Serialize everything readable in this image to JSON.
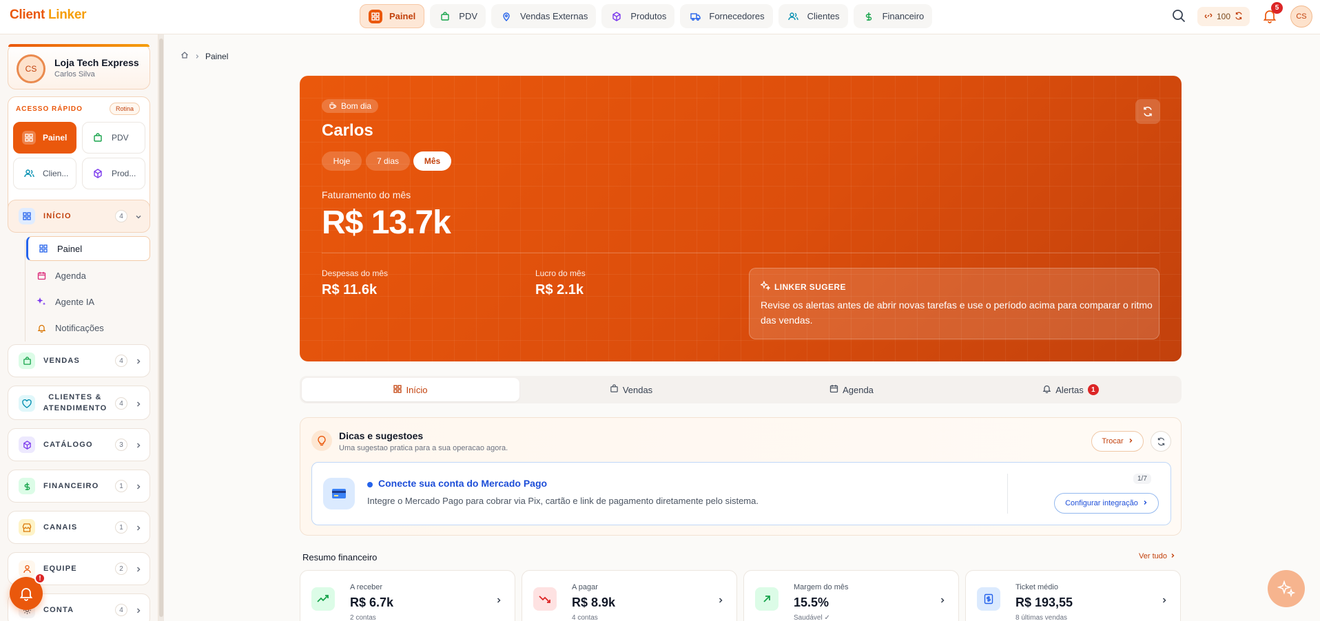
{
  "app": {
    "brand_1": "Client",
    "brand_2": "Linker"
  },
  "nav": [
    {
      "label": "Painel",
      "icon": "grid-icon"
    },
    {
      "label": "PDV",
      "icon": "bag-icon"
    },
    {
      "label": "Vendas Externas",
      "icon": "map-pin-icon"
    },
    {
      "label": "Produtos",
      "icon": "box-icon"
    },
    {
      "label": "Fornecedores",
      "icon": "truck-icon"
    },
    {
      "label": "Clientes",
      "icon": "users-icon"
    },
    {
      "label": "Financeiro",
      "icon": "dollar-icon"
    }
  ],
  "topbar": {
    "coins": "100",
    "notifications": "5",
    "avatar": "CS"
  },
  "store": {
    "initials": "CS",
    "name": "Loja Tech Express",
    "user": "Carlos Silva"
  },
  "quick": {
    "title": "ACESSO RÁPIDO",
    "tag": "Rotina",
    "items": [
      {
        "label": "Painel"
      },
      {
        "label": "PDV"
      },
      {
        "label": "Clien..."
      },
      {
        "label": "Prod..."
      }
    ]
  },
  "groups": [
    {
      "label": "INÍCIO",
      "count": "4"
    },
    {
      "label": "VENDAS",
      "count": "4"
    },
    {
      "label": "CLIENTES &",
      "label2": "ATENDIMENTO",
      "count": "4"
    },
    {
      "label": "CATÁLOGO",
      "count": "3"
    },
    {
      "label": "FINANCEIRO",
      "count": "1"
    },
    {
      "label": "CANAIS",
      "count": "1"
    },
    {
      "label": "EQUIPE",
      "count": "2"
    },
    {
      "label": "CONTA",
      "count": "4"
    }
  ],
  "inicio_items": [
    {
      "label": "Painel"
    },
    {
      "label": "Agenda"
    },
    {
      "label": "Agente IA"
    },
    {
      "label": "Notificações"
    }
  ],
  "float_badge": "!",
  "breadcrumb": {
    "current": "Painel"
  },
  "hero": {
    "greeting": "Bom dia",
    "name": "Carlos",
    "periods": [
      "Hoje",
      "7 dias",
      "Mês"
    ],
    "revenue_label": "Faturamento do mês",
    "revenue_value": "R$ 13.7k",
    "expenses_label": "Despesas do mês",
    "expenses_value": "R$ 11.6k",
    "profit_label": "Lucro do mês",
    "profit_value": "R$ 2.1k",
    "suggest_title": "LINKER SUGERE",
    "suggest_body": "Revise os alertas antes de abrir novas tarefas e use o período acima para comparar o ritmo das vendas."
  },
  "tabs": [
    {
      "label": "Início"
    },
    {
      "label": "Vendas"
    },
    {
      "label": "Agenda"
    },
    {
      "label": "Alertas",
      "badge": "1"
    }
  ],
  "tips": {
    "title": "Dicas e sugestoes",
    "subtitle": "Uma sugestao pratica para a sua operacao agora.",
    "swap": "Trocar",
    "card_title": "Conecte sua conta do Mercado Pago",
    "card_body": "Integre o Mercado Pago para cobrar via Pix, cartão e link de pagamento diretamente pelo sistema.",
    "counter": "1/7",
    "cta": "Configurar integração"
  },
  "finance": {
    "title": "Resumo financeiro",
    "more": "Ver tudo",
    "cards": [
      {
        "label": "A receber",
        "value": "R$ 6.7k",
        "sub": "2 contas"
      },
      {
        "label": "A pagar",
        "value": "R$ 8.9k",
        "sub": "4 contas"
      },
      {
        "label": "Margem do mês",
        "value": "15.5%",
        "sub": "Saudável ✓"
      },
      {
        "label": "Ticket médio",
        "value": "R$ 193,55",
        "sub": "8 últimas vendas"
      }
    ]
  },
  "colors": {
    "accent": "#ea580c",
    "brand_secondary": "#f59e0b",
    "danger": "#dc2626",
    "info": "#2563eb"
  }
}
